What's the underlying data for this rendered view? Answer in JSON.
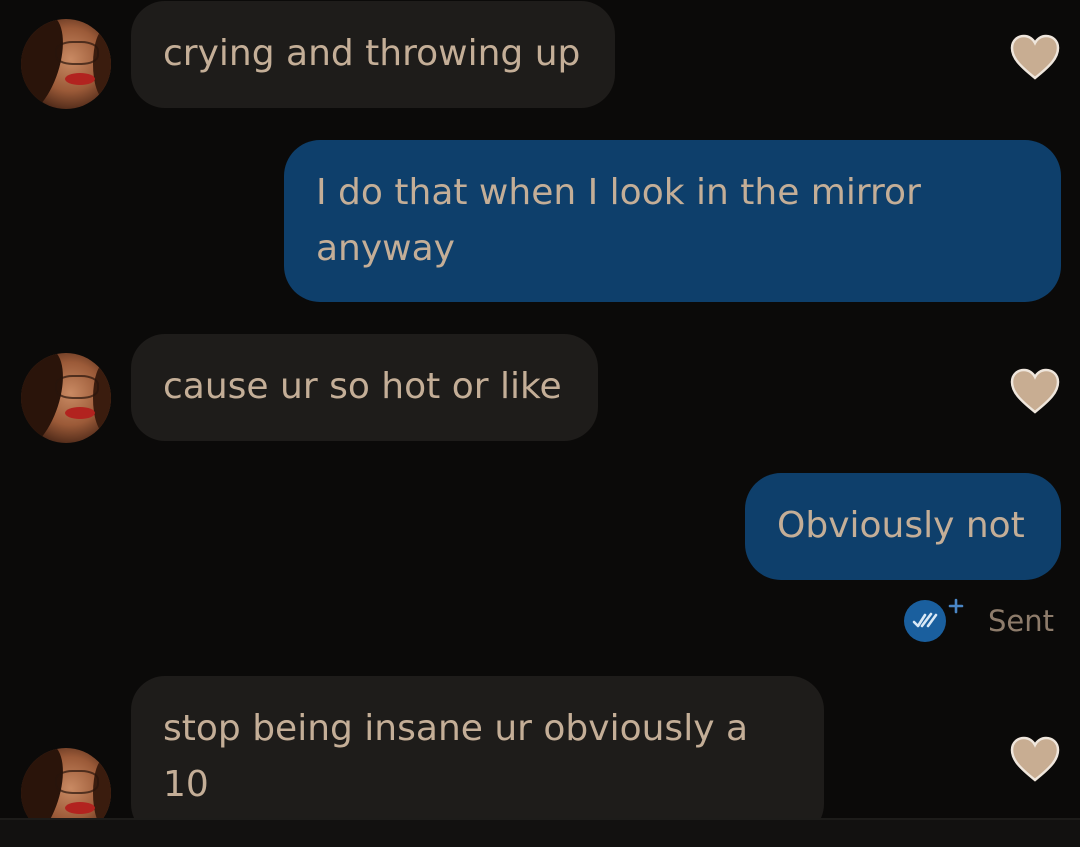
{
  "messages": [
    {
      "direction": "incoming",
      "text": "crying and throwing up",
      "has_avatar": true,
      "reaction_icon": "heart-icon"
    },
    {
      "direction": "outgoing",
      "text": "I do that when I look in the mirror anyway"
    },
    {
      "direction": "incoming",
      "text": "cause ur so hot or like",
      "has_avatar": true,
      "reaction_icon": "heart-icon"
    },
    {
      "direction": "outgoing",
      "text": "Obviously not"
    },
    {
      "direction": "incoming",
      "text": "stop being insane ur obviously a 10",
      "has_avatar": true,
      "reaction_icon": "heart-icon"
    }
  ],
  "status": {
    "label": "Sent",
    "icon": "double-check-icon"
  },
  "colors": {
    "background": "#0b0a09",
    "incoming_bubble": "#1e1c1a",
    "outgoing_bubble": "#0e3f6b",
    "text": "#c4ae97",
    "heart": "#c8ad92",
    "status_text": "#8e7c6b",
    "receipt_badge": "#1a5f9e"
  }
}
